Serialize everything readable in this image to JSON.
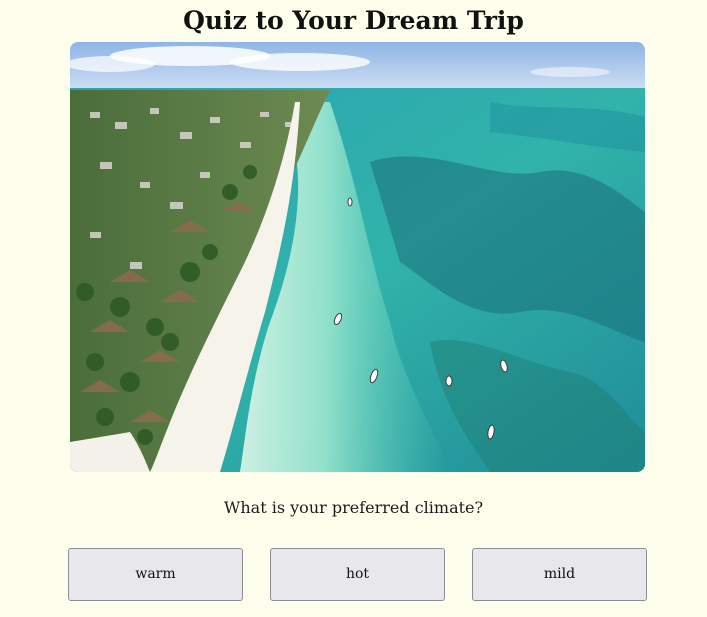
{
  "page": {
    "title": "Quiz to Your Dream Trip",
    "background": "#fefeec"
  },
  "hero_image": {
    "subject": "aerial view of tropical beach with turquoise lagoon, white sand, palm trees and boats",
    "colors": {
      "sky": "#a9c6ea",
      "ocean_deep": "#1f9fab",
      "ocean_shallow": "#7fe0c6",
      "sand": "#f4f1ea",
      "palms": "#3f6b34"
    }
  },
  "quiz": {
    "question": "What is your preferred climate?",
    "answers": [
      {
        "label": "warm"
      },
      {
        "label": "hot"
      },
      {
        "label": "mild"
      }
    ]
  }
}
